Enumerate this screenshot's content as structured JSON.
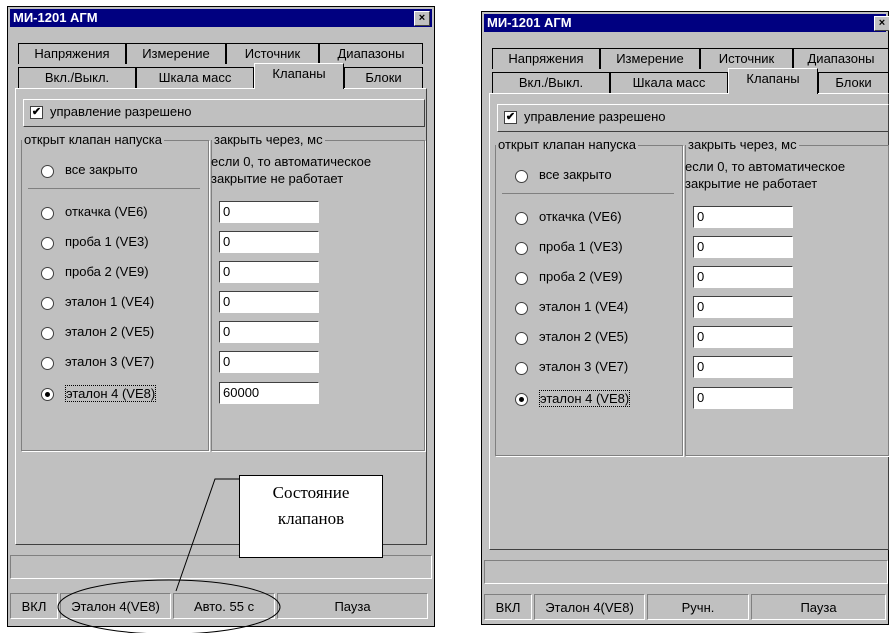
{
  "window1": {
    "title": "МИ-1201 АГМ",
    "close": "×",
    "tabs_row1": [
      "Напряжения",
      "Измерение",
      "Источник",
      "Диапазоны"
    ],
    "tabs_row2": [
      "Вкл./Выкл.",
      "Шкала масс",
      "Клапаны",
      "Блоки"
    ],
    "active_tab": "Клапаны",
    "control_checkbox": {
      "label": "управление разрешено",
      "checked": true
    },
    "group_open": "открыт клапан напуска",
    "group_close": "закрыть через, мс",
    "close_note": [
      "если 0, то автоматическое",
      "закрытие не работает"
    ],
    "radio_all": "все закрыто",
    "valves": [
      {
        "label": "откачка (VE6)",
        "value": "0",
        "selected": false
      },
      {
        "label": "проба 1 (VE3)",
        "value": "0",
        "selected": false
      },
      {
        "label": "проба 2 (VE9)",
        "value": "0",
        "selected": false
      },
      {
        "label": "эталон 1 (VE4)",
        "value": "0",
        "selected": false
      },
      {
        "label": "эталон 2 (VE5)",
        "value": "0",
        "selected": false
      },
      {
        "label": "эталон 3 (VE7)",
        "value": "0",
        "selected": false
      },
      {
        "label": "эталон 4 (VE8)",
        "value": "60000",
        "selected": true
      }
    ],
    "status": [
      "ВКЛ",
      "Эталон 4(VE8)",
      "Авто. 55 с",
      "Пауза"
    ]
  },
  "window2": {
    "title": "МИ-1201 АГМ",
    "close": "×",
    "tabs_row1": [
      "Напряжения",
      "Измерение",
      "Источник",
      "Диапазоны"
    ],
    "tabs_row2": [
      "Вкл./Выкл.",
      "Шкала масс",
      "Клапаны",
      "Блоки"
    ],
    "active_tab": "Клапаны",
    "control_checkbox": {
      "label": "управление разрешено",
      "checked": true
    },
    "group_open": "открыт клапан напуска",
    "group_close": "закрыть через, мс",
    "close_note": [
      "если 0, то автоматическое",
      "закрытие не работает"
    ],
    "radio_all": "все закрыто",
    "valves": [
      {
        "label": "откачка (VE6)",
        "value": "0",
        "selected": false
      },
      {
        "label": "проба 1 (VE3)",
        "value": "0",
        "selected": false
      },
      {
        "label": "проба 2 (VE9)",
        "value": "0",
        "selected": false
      },
      {
        "label": "эталон 1 (VE4)",
        "value": "0",
        "selected": false
      },
      {
        "label": "эталон 2 (VE5)",
        "value": "0",
        "selected": false
      },
      {
        "label": "эталон 3 (VE7)",
        "value": "0",
        "selected": false
      },
      {
        "label": "эталон 4 (VE8)",
        "value": "0",
        "selected": true
      }
    ],
    "status": [
      "ВКЛ",
      "Эталон 4(VE8)",
      "Ручн.",
      "Пауза"
    ]
  },
  "annotation": {
    "line1": "Состояние",
    "line2": "клапанов"
  }
}
